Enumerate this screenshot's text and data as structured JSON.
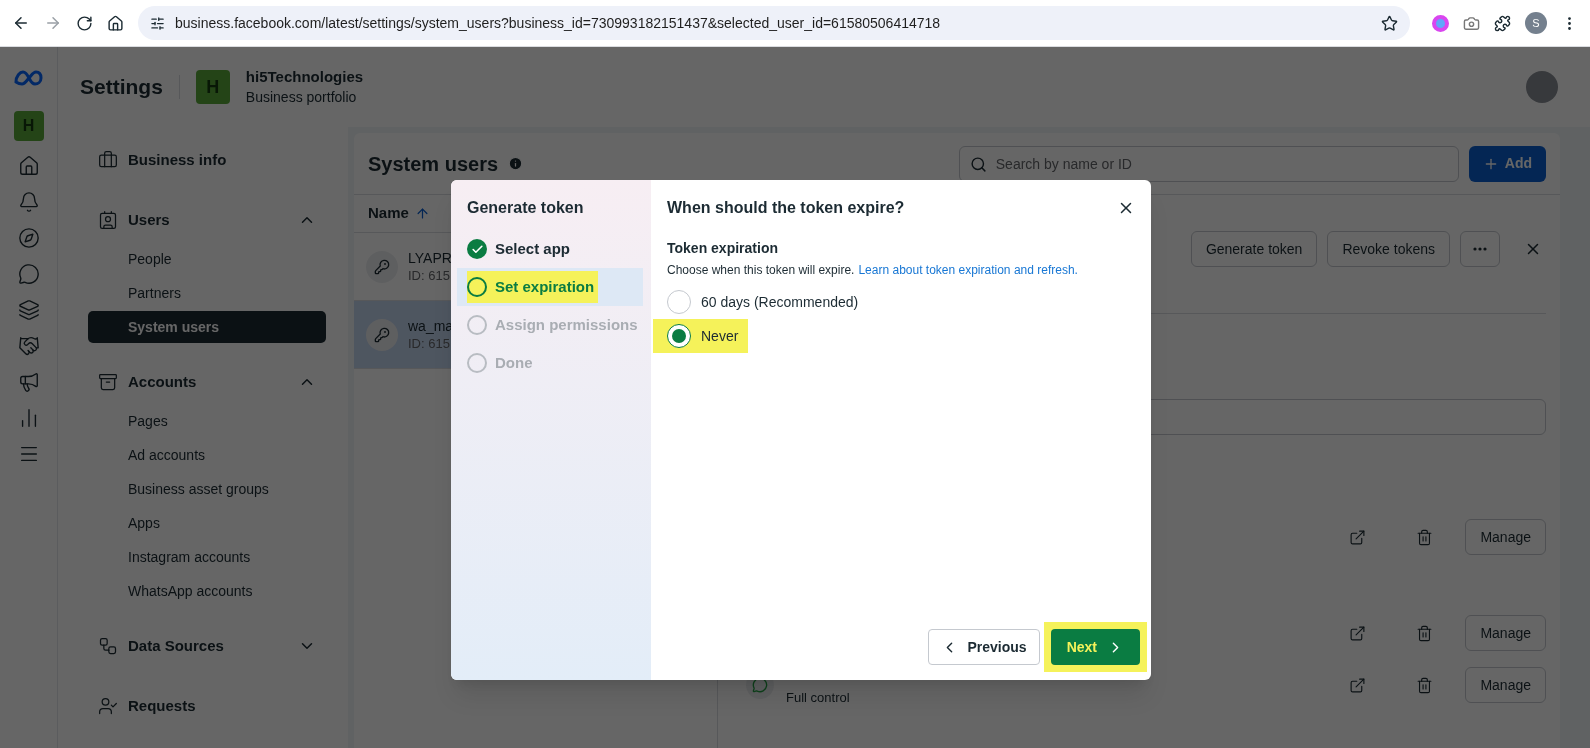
{
  "browser": {
    "url": "business.facebook.com/latest/settings/system_users?business_id=730993182151437&selected_user_id=61580506414718",
    "profile_initial": "S"
  },
  "header": {
    "title": "Settings",
    "business": {
      "initial": "H",
      "name": "hi5Technologies",
      "subtitle": "Business portfolio"
    }
  },
  "rail": {
    "initial": "H"
  },
  "sidebar": {
    "sections": [
      {
        "label": "Business info"
      },
      {
        "label": "Users",
        "expanded": true,
        "children": [
          {
            "label": "People",
            "selected": false
          },
          {
            "label": "Partners",
            "selected": false
          },
          {
            "label": "System users",
            "selected": true
          }
        ]
      },
      {
        "label": "Accounts",
        "expanded": true,
        "children": [
          {
            "label": "Pages",
            "selected": false
          },
          {
            "label": "Ad accounts",
            "selected": false
          },
          {
            "label": "Business asset groups",
            "selected": false
          },
          {
            "label": "Apps",
            "selected": false
          },
          {
            "label": "Instagram accounts",
            "selected": false
          },
          {
            "label": "WhatsApp accounts",
            "selected": false
          }
        ]
      },
      {
        "label": "Data Sources",
        "expanded": false
      },
      {
        "label": "Requests"
      }
    ]
  },
  "content": {
    "title": "System users",
    "search": {
      "placeholder": "Search by name or ID"
    },
    "add_button": "Add",
    "column": "Name",
    "rows": [
      {
        "name": "LYAPR",
        "id": "ID: 615",
        "selected": false
      },
      {
        "name": "wa_ma",
        "id": "ID: 615",
        "selected": true
      }
    ],
    "detail": {
      "buttons": [
        "Generate token",
        "Revoke tokens"
      ],
      "assets": [
        {
          "manage": "Manage"
        },
        {
          "manage": "Manage"
        },
        {
          "subtitle": "Full control",
          "manage": "Manage"
        }
      ]
    }
  },
  "modal": {
    "title": "Generate token",
    "steps": [
      {
        "label": "Select app",
        "completed": true,
        "selected": false,
        "highlighted": false
      },
      {
        "label": "Set expiration",
        "completed": false,
        "selected": true,
        "highlighted": true
      },
      {
        "label": "Assign permissions",
        "completed": false,
        "selected": false,
        "highlighted": false
      },
      {
        "label": "Done",
        "completed": false,
        "selected": false,
        "highlighted": false
      }
    ],
    "heading": "When should the token expire?",
    "section_title": "Token expiration",
    "description": "Choose when this token will expire.",
    "link": "Learn about token expiration and refresh.",
    "options": [
      {
        "label": "60 days (Recommended)",
        "selected": false,
        "highlighted": false
      },
      {
        "label": "Never",
        "selected": true,
        "highlighted": true
      }
    ],
    "previous": "Previous",
    "next": {
      "label": "Next",
      "highlighted": true
    }
  }
}
